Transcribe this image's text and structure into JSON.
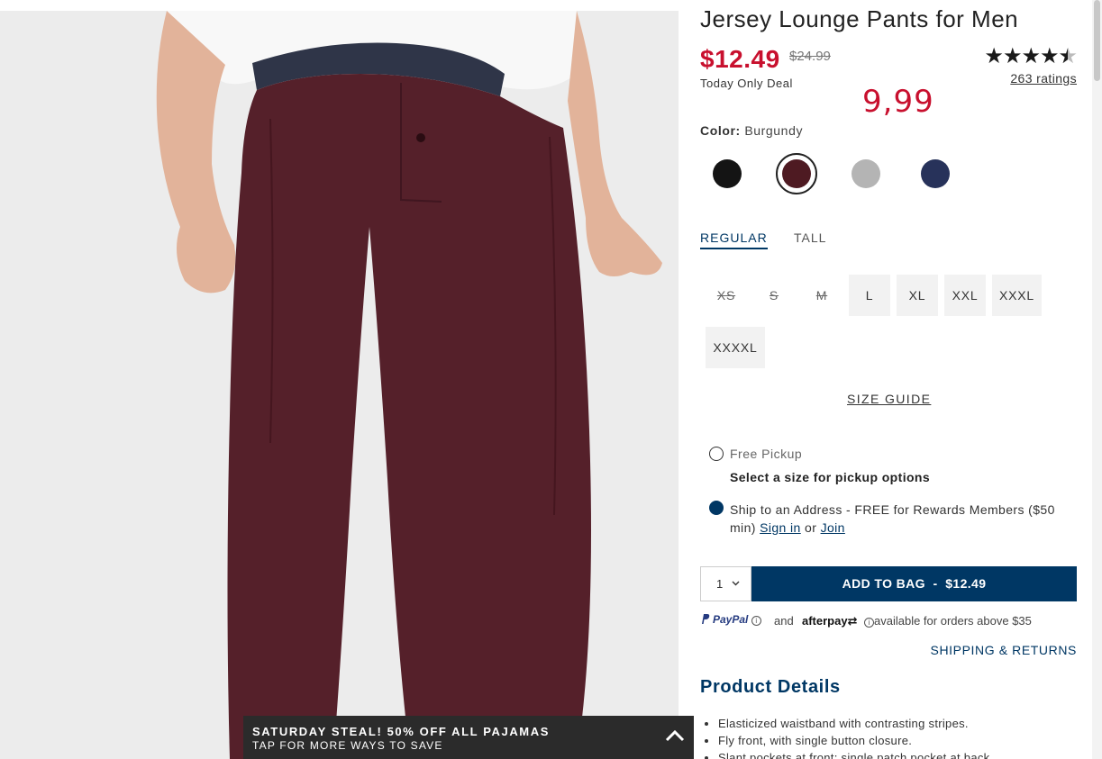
{
  "product": {
    "title": "Jersey Lounge Pants for Men",
    "sale_price": "$12.49",
    "original_price": "$24.99",
    "deal_label": "Today Only Deal",
    "handwritten_note": "9,99",
    "rating_value": 4.5,
    "rating_stars": "★★★★",
    "ratings_link": "263 ratings"
  },
  "color": {
    "label": "Color:",
    "selected": "Burgundy",
    "swatches": [
      {
        "name": "Black",
        "hex": "#141414"
      },
      {
        "name": "Burgundy",
        "hex": "#4e1a22"
      },
      {
        "name": "Gray",
        "hex": "#b4b4b4"
      },
      {
        "name": "Navy",
        "hex": "#27325a"
      }
    ]
  },
  "fit": {
    "tabs": [
      {
        "label": "REGULAR",
        "active": true
      },
      {
        "label": "TALL",
        "active": false
      }
    ]
  },
  "sizes": [
    {
      "label": "XS",
      "available": false
    },
    {
      "label": "S",
      "available": false
    },
    {
      "label": "M",
      "available": false
    },
    {
      "label": "L",
      "available": true
    },
    {
      "label": "XL",
      "available": true
    },
    {
      "label": "XXL",
      "available": true
    },
    {
      "label": "XXXL",
      "available": true
    },
    {
      "label": "XXXXL",
      "available": true
    }
  ],
  "size_guide": "SIZE GUIDE",
  "fulfillment": {
    "pickup_label": "Free Pickup",
    "pickup_note": "Select a size for pickup options",
    "ship_label": "Ship to an Address - FREE for Rewards Members ($50 min)",
    "sign_in": "Sign in",
    "or": "or",
    "join": "Join"
  },
  "cart": {
    "quantity": "1",
    "add_to_bag": "ADD TO BAG  -  $12.49"
  },
  "payment": {
    "paypal": "PayPal",
    "and": "and",
    "afterpay": "afterpay",
    "availability": "available for orders above $35"
  },
  "shipping_returns": "SHIPPING & RETURNS",
  "details": {
    "heading": "Product Details",
    "items": [
      "Elasticized waistband with contrasting stripes.",
      "Fly front, with single button closure.",
      "Slant pockets at front; single patch pocket at back."
    ]
  },
  "promo": {
    "title": "SATURDAY STEAL! 50% OFF ALL PAJAMAS",
    "subtitle": "TAP FOR MORE WAYS TO SAVE"
  },
  "colors": {
    "brand_navy": "#003764",
    "sale_red": "#c8102e",
    "pants": "#55202a"
  }
}
